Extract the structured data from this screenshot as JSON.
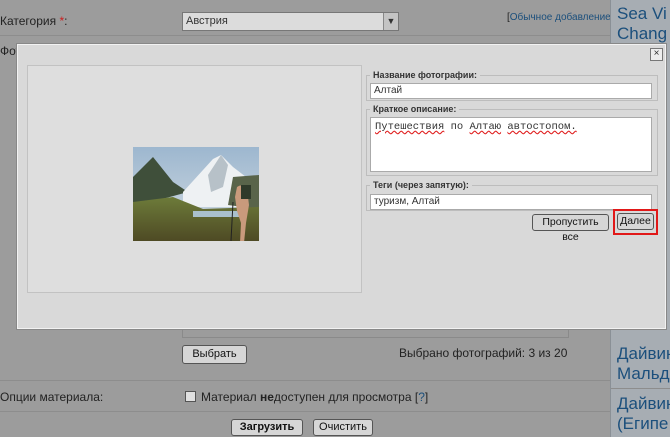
{
  "background": {
    "category_label": "Категория",
    "required_star": "*",
    "category_colon": ":",
    "category_value": "Австрия",
    "plain_add_prefix": "[",
    "plain_add_link": "Обычное добавление",
    "plain_add_suffix": "]",
    "photos_label_fragment": "Фот",
    "choose_button": "Выбрать",
    "selected_count": "Выбрано фотографий: 3 из 20",
    "options_label": "Опции материала:",
    "unavailable_pre": "Материал ",
    "unavailable_bold": "не",
    "unavailable_post": "доступен для просмотра [",
    "help_mark": "?",
    "help_close": "]",
    "upload_button": "Загрузить",
    "clear_button": "Очистить"
  },
  "right_column": {
    "links": [
      "Sea Vi",
      "Chang",
      "Дайвин",
      "Мальд",
      "Дайвин",
      "(Египе"
    ]
  },
  "modal": {
    "close_symbol": "×",
    "title_legend": "Название фотографии:",
    "title_value": "Алтай",
    "desc_legend": "Краткое описание:",
    "desc_words": [
      "Путешествия",
      "по",
      "Алтаю",
      "автостопом."
    ],
    "tags_legend": "Теги (через запятую):",
    "tags_value": "туризм, Алтай",
    "skip_all_button": "Пропустить все",
    "next_button": "Далее"
  },
  "colors": {
    "highlight_border": "#e11818",
    "link_blue": "#1b4f7c",
    "required_red": "#cc1f1f"
  }
}
